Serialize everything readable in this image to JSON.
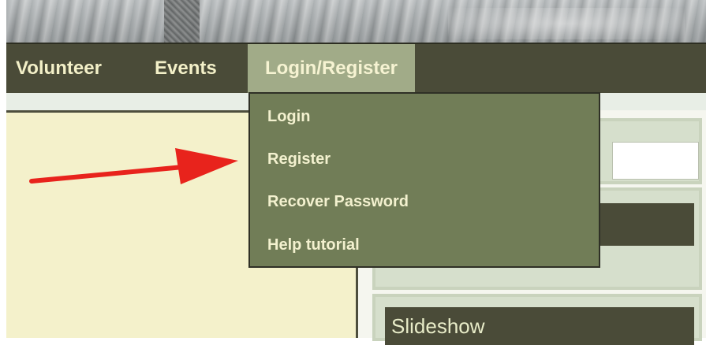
{
  "navbar": {
    "items": [
      {
        "label": "Volunteer"
      },
      {
        "label": "Events"
      },
      {
        "label": "Login/Register"
      }
    ]
  },
  "dropdown": {
    "items": [
      {
        "label": "Login"
      },
      {
        "label": "Register"
      },
      {
        "label": "Recover Password"
      },
      {
        "label": "Help tutorial"
      }
    ]
  },
  "sidebar": {
    "slideshow_title": "Slideshow"
  },
  "colors": {
    "nav_bg": "#4a4b38",
    "nav_active_bg": "#a1ab88",
    "dropdown_bg": "#717d57",
    "nav_text": "#f3f0c8",
    "annotation_arrow": "#e8231c"
  },
  "annotation": {
    "arrow_icon": "red-arrow-icon"
  }
}
